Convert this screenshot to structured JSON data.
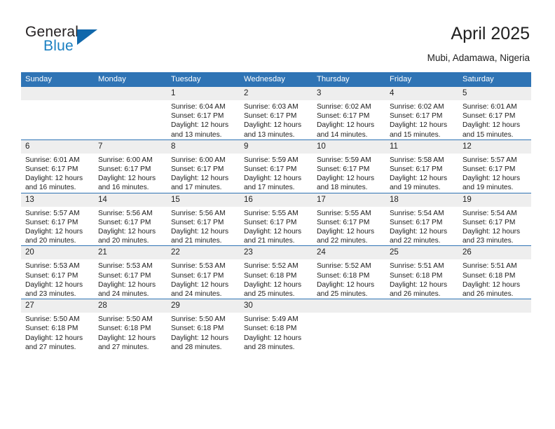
{
  "brand": {
    "name_top": "General",
    "name_bottom": "Blue",
    "color_dark": "#231f20",
    "color_blue": "#1a7fc1",
    "triangle_color": "#1168ab"
  },
  "header": {
    "title": "April 2025",
    "subtitle": "Mubi, Adamawa, Nigeria"
  },
  "calendar": {
    "accent_color": "#2f74b5",
    "daynum_bg": "#eeeeee",
    "weekday_headers": [
      "Sunday",
      "Monday",
      "Tuesday",
      "Wednesday",
      "Thursday",
      "Friday",
      "Saturday"
    ],
    "weeks": [
      [
        {
          "day": "",
          "sunrise": "",
          "sunset": "",
          "daylight_line1": "",
          "daylight_line2": "",
          "empty": true
        },
        {
          "day": "",
          "sunrise": "",
          "sunset": "",
          "daylight_line1": "",
          "daylight_line2": "",
          "empty": true
        },
        {
          "day": "1",
          "sunrise": "Sunrise: 6:04 AM",
          "sunset": "Sunset: 6:17 PM",
          "daylight_line1": "Daylight: 12 hours",
          "daylight_line2": "and 13 minutes."
        },
        {
          "day": "2",
          "sunrise": "Sunrise: 6:03 AM",
          "sunset": "Sunset: 6:17 PM",
          "daylight_line1": "Daylight: 12 hours",
          "daylight_line2": "and 13 minutes."
        },
        {
          "day": "3",
          "sunrise": "Sunrise: 6:02 AM",
          "sunset": "Sunset: 6:17 PM",
          "daylight_line1": "Daylight: 12 hours",
          "daylight_line2": "and 14 minutes."
        },
        {
          "day": "4",
          "sunrise": "Sunrise: 6:02 AM",
          "sunset": "Sunset: 6:17 PM",
          "daylight_line1": "Daylight: 12 hours",
          "daylight_line2": "and 15 minutes."
        },
        {
          "day": "5",
          "sunrise": "Sunrise: 6:01 AM",
          "sunset": "Sunset: 6:17 PM",
          "daylight_line1": "Daylight: 12 hours",
          "daylight_line2": "and 15 minutes."
        }
      ],
      [
        {
          "day": "6",
          "sunrise": "Sunrise: 6:01 AM",
          "sunset": "Sunset: 6:17 PM",
          "daylight_line1": "Daylight: 12 hours",
          "daylight_line2": "and 16 minutes."
        },
        {
          "day": "7",
          "sunrise": "Sunrise: 6:00 AM",
          "sunset": "Sunset: 6:17 PM",
          "daylight_line1": "Daylight: 12 hours",
          "daylight_line2": "and 16 minutes."
        },
        {
          "day": "8",
          "sunrise": "Sunrise: 6:00 AM",
          "sunset": "Sunset: 6:17 PM",
          "daylight_line1": "Daylight: 12 hours",
          "daylight_line2": "and 17 minutes."
        },
        {
          "day": "9",
          "sunrise": "Sunrise: 5:59 AM",
          "sunset": "Sunset: 6:17 PM",
          "daylight_line1": "Daylight: 12 hours",
          "daylight_line2": "and 17 minutes."
        },
        {
          "day": "10",
          "sunrise": "Sunrise: 5:59 AM",
          "sunset": "Sunset: 6:17 PM",
          "daylight_line1": "Daylight: 12 hours",
          "daylight_line2": "and 18 minutes."
        },
        {
          "day": "11",
          "sunrise": "Sunrise: 5:58 AM",
          "sunset": "Sunset: 6:17 PM",
          "daylight_line1": "Daylight: 12 hours",
          "daylight_line2": "and 19 minutes."
        },
        {
          "day": "12",
          "sunrise": "Sunrise: 5:57 AM",
          "sunset": "Sunset: 6:17 PM",
          "daylight_line1": "Daylight: 12 hours",
          "daylight_line2": "and 19 minutes."
        }
      ],
      [
        {
          "day": "13",
          "sunrise": "Sunrise: 5:57 AM",
          "sunset": "Sunset: 6:17 PM",
          "daylight_line1": "Daylight: 12 hours",
          "daylight_line2": "and 20 minutes."
        },
        {
          "day": "14",
          "sunrise": "Sunrise: 5:56 AM",
          "sunset": "Sunset: 6:17 PM",
          "daylight_line1": "Daylight: 12 hours",
          "daylight_line2": "and 20 minutes."
        },
        {
          "day": "15",
          "sunrise": "Sunrise: 5:56 AM",
          "sunset": "Sunset: 6:17 PM",
          "daylight_line1": "Daylight: 12 hours",
          "daylight_line2": "and 21 minutes."
        },
        {
          "day": "16",
          "sunrise": "Sunrise: 5:55 AM",
          "sunset": "Sunset: 6:17 PM",
          "daylight_line1": "Daylight: 12 hours",
          "daylight_line2": "and 21 minutes."
        },
        {
          "day": "17",
          "sunrise": "Sunrise: 5:55 AM",
          "sunset": "Sunset: 6:17 PM",
          "daylight_line1": "Daylight: 12 hours",
          "daylight_line2": "and 22 minutes."
        },
        {
          "day": "18",
          "sunrise": "Sunrise: 5:54 AM",
          "sunset": "Sunset: 6:17 PM",
          "daylight_line1": "Daylight: 12 hours",
          "daylight_line2": "and 22 minutes."
        },
        {
          "day": "19",
          "sunrise": "Sunrise: 5:54 AM",
          "sunset": "Sunset: 6:17 PM",
          "daylight_line1": "Daylight: 12 hours",
          "daylight_line2": "and 23 minutes."
        }
      ],
      [
        {
          "day": "20",
          "sunrise": "Sunrise: 5:53 AM",
          "sunset": "Sunset: 6:17 PM",
          "daylight_line1": "Daylight: 12 hours",
          "daylight_line2": "and 23 minutes."
        },
        {
          "day": "21",
          "sunrise": "Sunrise: 5:53 AM",
          "sunset": "Sunset: 6:17 PM",
          "daylight_line1": "Daylight: 12 hours",
          "daylight_line2": "and 24 minutes."
        },
        {
          "day": "22",
          "sunrise": "Sunrise: 5:53 AM",
          "sunset": "Sunset: 6:17 PM",
          "daylight_line1": "Daylight: 12 hours",
          "daylight_line2": "and 24 minutes."
        },
        {
          "day": "23",
          "sunrise": "Sunrise: 5:52 AM",
          "sunset": "Sunset: 6:18 PM",
          "daylight_line1": "Daylight: 12 hours",
          "daylight_line2": "and 25 minutes."
        },
        {
          "day": "24",
          "sunrise": "Sunrise: 5:52 AM",
          "sunset": "Sunset: 6:18 PM",
          "daylight_line1": "Daylight: 12 hours",
          "daylight_line2": "and 25 minutes."
        },
        {
          "day": "25",
          "sunrise": "Sunrise: 5:51 AM",
          "sunset": "Sunset: 6:18 PM",
          "daylight_line1": "Daylight: 12 hours",
          "daylight_line2": "and 26 minutes."
        },
        {
          "day": "26",
          "sunrise": "Sunrise: 5:51 AM",
          "sunset": "Sunset: 6:18 PM",
          "daylight_line1": "Daylight: 12 hours",
          "daylight_line2": "and 26 minutes."
        }
      ],
      [
        {
          "day": "27",
          "sunrise": "Sunrise: 5:50 AM",
          "sunset": "Sunset: 6:18 PM",
          "daylight_line1": "Daylight: 12 hours",
          "daylight_line2": "and 27 minutes."
        },
        {
          "day": "28",
          "sunrise": "Sunrise: 5:50 AM",
          "sunset": "Sunset: 6:18 PM",
          "daylight_line1": "Daylight: 12 hours",
          "daylight_line2": "and 27 minutes."
        },
        {
          "day": "29",
          "sunrise": "Sunrise: 5:50 AM",
          "sunset": "Sunset: 6:18 PM",
          "daylight_line1": "Daylight: 12 hours",
          "daylight_line2": "and 28 minutes."
        },
        {
          "day": "30",
          "sunrise": "Sunrise: 5:49 AM",
          "sunset": "Sunset: 6:18 PM",
          "daylight_line1": "Daylight: 12 hours",
          "daylight_line2": "and 28 minutes."
        },
        {
          "day": "",
          "sunrise": "",
          "sunset": "",
          "daylight_line1": "",
          "daylight_line2": "",
          "empty": true
        },
        {
          "day": "",
          "sunrise": "",
          "sunset": "",
          "daylight_line1": "",
          "daylight_line2": "",
          "empty": true
        },
        {
          "day": "",
          "sunrise": "",
          "sunset": "",
          "daylight_line1": "",
          "daylight_line2": "",
          "empty": true
        }
      ]
    ]
  }
}
